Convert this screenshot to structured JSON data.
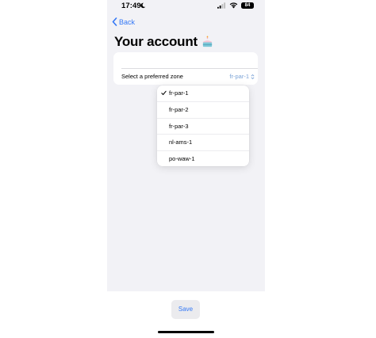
{
  "status_bar": {
    "time": "17:49",
    "battery": "84",
    "icons": [
      "moon-icon",
      "signal-icon",
      "wifi-icon",
      "battery-icon"
    ]
  },
  "nav": {
    "back_label": "Back"
  },
  "page": {
    "title": "Your account",
    "title_icon": "cake-icon"
  },
  "zone": {
    "label": "Select a preferred zone",
    "selected": "fr-par-1",
    "options": [
      {
        "label": "fr-par-1",
        "checked": true
      },
      {
        "label": "fr-par-2",
        "checked": false
      },
      {
        "label": "fr-par-3",
        "checked": false
      },
      {
        "label": "nl-ams-1",
        "checked": false
      },
      {
        "label": "po-waw-1",
        "checked": false
      }
    ]
  },
  "footer": {
    "save_label": "Save"
  },
  "colors": {
    "accent": "#3478f6",
    "background": "#f2f2f6",
    "card": "#ffffff"
  }
}
